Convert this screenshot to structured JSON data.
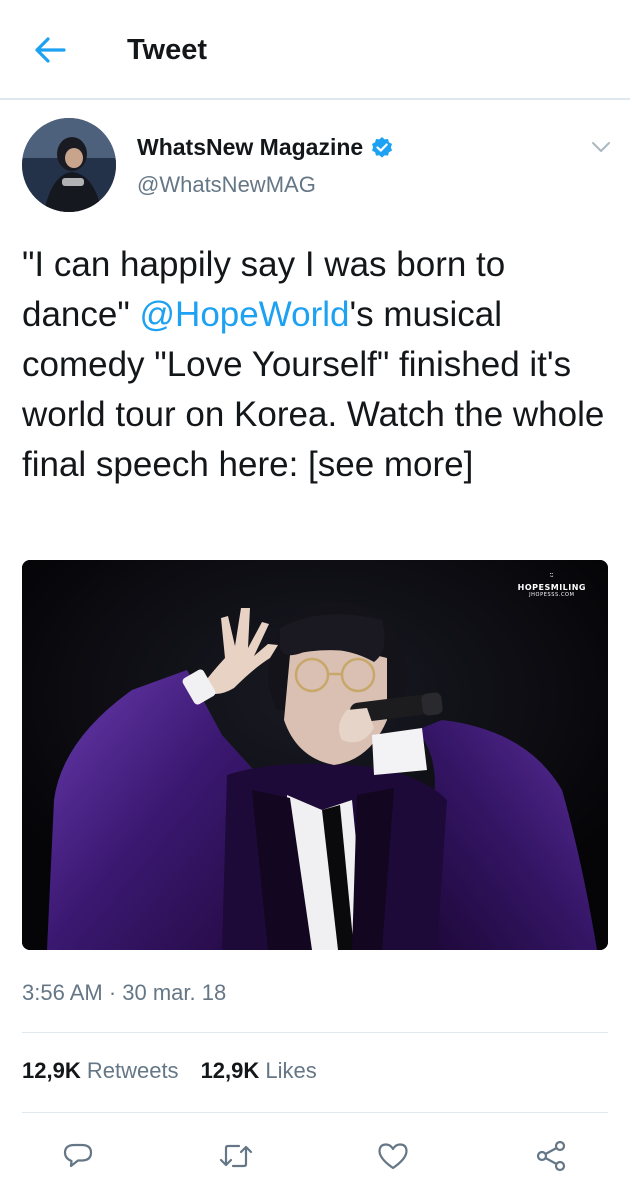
{
  "header": {
    "title": "Tweet",
    "back_icon": "arrow-left-icon"
  },
  "author": {
    "name": "WhatsNew Magazine",
    "handle": "@WhatsNewMAG",
    "verified_icon": "verified-badge-icon"
  },
  "tweet": {
    "text_before": "\"I can happily say I was born to dance\" ",
    "mention": "@HopeWorld",
    "text_after": "'s musical comedy \"Love Yourself\" finished it's world tour on Korea. Watch the whole final speech here: [see more]",
    "timestamp": "3:56 AM · 30 mar. 18"
  },
  "media": {
    "watermark_title": "HOPESMILING",
    "watermark_sub": "JHOPESSS.COM",
    "watermark_smile": "ᵕ̈"
  },
  "stats": {
    "retweets_count": "12,9K",
    "retweets_label": "Retweets",
    "likes_count": "12,9K",
    "likes_label": "Likes"
  },
  "actions": [
    "reply-icon",
    "retweet-icon",
    "like-icon",
    "share-icon"
  ],
  "colors": {
    "accent": "#1da1f2",
    "secondary_text": "#657786",
    "divider": "#e1e8ed"
  }
}
